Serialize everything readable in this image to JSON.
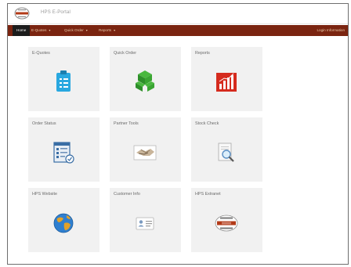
{
  "app": {
    "title": "HPS E-Portal"
  },
  "nav": {
    "home": "Home",
    "items": [
      "E-Quotes",
      "Quick Order",
      "Reports"
    ],
    "right": "Login Information"
  },
  "tiles": [
    {
      "label": "E-Quotes",
      "icon": "clipboard-icon"
    },
    {
      "label": "Quick Order",
      "icon": "box-stack-icon"
    },
    {
      "label": "Reports",
      "icon": "bar-chart-icon"
    },
    {
      "label": "Order Status",
      "icon": "order-form-icon"
    },
    {
      "label": "Partner Tools",
      "icon": "handshake-icon"
    },
    {
      "label": "Stock Check",
      "icon": "magnifier-document-icon"
    },
    {
      "label": "HPS Website",
      "icon": "globe-icon"
    },
    {
      "label": "Customer Info",
      "icon": "id-card-icon"
    },
    {
      "label": "HPS Extranet",
      "icon": "hps-logo-icon"
    }
  ],
  "colors": {
    "navbar": "#7a2410",
    "nav_active": "#1c1c1c",
    "tile_bg": "#f1f1f1"
  }
}
